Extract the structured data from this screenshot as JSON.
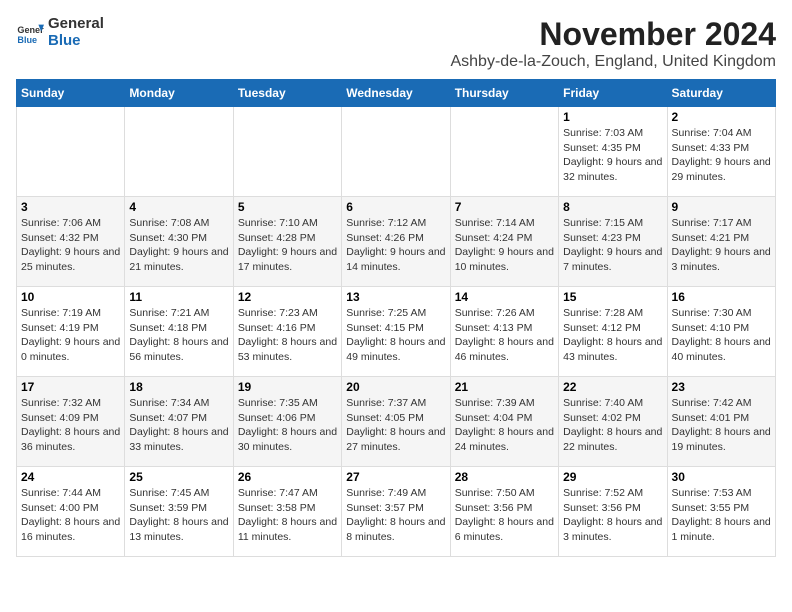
{
  "logo": {
    "general": "General",
    "blue": "Blue"
  },
  "header": {
    "month": "November 2024",
    "location": "Ashby-de-la-Zouch, England, United Kingdom"
  },
  "weekdays": [
    "Sunday",
    "Monday",
    "Tuesday",
    "Wednesday",
    "Thursday",
    "Friday",
    "Saturday"
  ],
  "weeks": [
    [
      {
        "day": "",
        "info": ""
      },
      {
        "day": "",
        "info": ""
      },
      {
        "day": "",
        "info": ""
      },
      {
        "day": "",
        "info": ""
      },
      {
        "day": "",
        "info": ""
      },
      {
        "day": "1",
        "info": "Sunrise: 7:03 AM\nSunset: 4:35 PM\nDaylight: 9 hours and 32 minutes."
      },
      {
        "day": "2",
        "info": "Sunrise: 7:04 AM\nSunset: 4:33 PM\nDaylight: 9 hours and 29 minutes."
      }
    ],
    [
      {
        "day": "3",
        "info": "Sunrise: 7:06 AM\nSunset: 4:32 PM\nDaylight: 9 hours and 25 minutes."
      },
      {
        "day": "4",
        "info": "Sunrise: 7:08 AM\nSunset: 4:30 PM\nDaylight: 9 hours and 21 minutes."
      },
      {
        "day": "5",
        "info": "Sunrise: 7:10 AM\nSunset: 4:28 PM\nDaylight: 9 hours and 17 minutes."
      },
      {
        "day": "6",
        "info": "Sunrise: 7:12 AM\nSunset: 4:26 PM\nDaylight: 9 hours and 14 minutes."
      },
      {
        "day": "7",
        "info": "Sunrise: 7:14 AM\nSunset: 4:24 PM\nDaylight: 9 hours and 10 minutes."
      },
      {
        "day": "8",
        "info": "Sunrise: 7:15 AM\nSunset: 4:23 PM\nDaylight: 9 hours and 7 minutes."
      },
      {
        "day": "9",
        "info": "Sunrise: 7:17 AM\nSunset: 4:21 PM\nDaylight: 9 hours and 3 minutes."
      }
    ],
    [
      {
        "day": "10",
        "info": "Sunrise: 7:19 AM\nSunset: 4:19 PM\nDaylight: 9 hours and 0 minutes."
      },
      {
        "day": "11",
        "info": "Sunrise: 7:21 AM\nSunset: 4:18 PM\nDaylight: 8 hours and 56 minutes."
      },
      {
        "day": "12",
        "info": "Sunrise: 7:23 AM\nSunset: 4:16 PM\nDaylight: 8 hours and 53 minutes."
      },
      {
        "day": "13",
        "info": "Sunrise: 7:25 AM\nSunset: 4:15 PM\nDaylight: 8 hours and 49 minutes."
      },
      {
        "day": "14",
        "info": "Sunrise: 7:26 AM\nSunset: 4:13 PM\nDaylight: 8 hours and 46 minutes."
      },
      {
        "day": "15",
        "info": "Sunrise: 7:28 AM\nSunset: 4:12 PM\nDaylight: 8 hours and 43 minutes."
      },
      {
        "day": "16",
        "info": "Sunrise: 7:30 AM\nSunset: 4:10 PM\nDaylight: 8 hours and 40 minutes."
      }
    ],
    [
      {
        "day": "17",
        "info": "Sunrise: 7:32 AM\nSunset: 4:09 PM\nDaylight: 8 hours and 36 minutes."
      },
      {
        "day": "18",
        "info": "Sunrise: 7:34 AM\nSunset: 4:07 PM\nDaylight: 8 hours and 33 minutes."
      },
      {
        "day": "19",
        "info": "Sunrise: 7:35 AM\nSunset: 4:06 PM\nDaylight: 8 hours and 30 minutes."
      },
      {
        "day": "20",
        "info": "Sunrise: 7:37 AM\nSunset: 4:05 PM\nDaylight: 8 hours and 27 minutes."
      },
      {
        "day": "21",
        "info": "Sunrise: 7:39 AM\nSunset: 4:04 PM\nDaylight: 8 hours and 24 minutes."
      },
      {
        "day": "22",
        "info": "Sunrise: 7:40 AM\nSunset: 4:02 PM\nDaylight: 8 hours and 22 minutes."
      },
      {
        "day": "23",
        "info": "Sunrise: 7:42 AM\nSunset: 4:01 PM\nDaylight: 8 hours and 19 minutes."
      }
    ],
    [
      {
        "day": "24",
        "info": "Sunrise: 7:44 AM\nSunset: 4:00 PM\nDaylight: 8 hours and 16 minutes."
      },
      {
        "day": "25",
        "info": "Sunrise: 7:45 AM\nSunset: 3:59 PM\nDaylight: 8 hours and 13 minutes."
      },
      {
        "day": "26",
        "info": "Sunrise: 7:47 AM\nSunset: 3:58 PM\nDaylight: 8 hours and 11 minutes."
      },
      {
        "day": "27",
        "info": "Sunrise: 7:49 AM\nSunset: 3:57 PM\nDaylight: 8 hours and 8 minutes."
      },
      {
        "day": "28",
        "info": "Sunrise: 7:50 AM\nSunset: 3:56 PM\nDaylight: 8 hours and 6 minutes."
      },
      {
        "day": "29",
        "info": "Sunrise: 7:52 AM\nSunset: 3:56 PM\nDaylight: 8 hours and 3 minutes."
      },
      {
        "day": "30",
        "info": "Sunrise: 7:53 AM\nSunset: 3:55 PM\nDaylight: 8 hours and 1 minute."
      }
    ]
  ]
}
